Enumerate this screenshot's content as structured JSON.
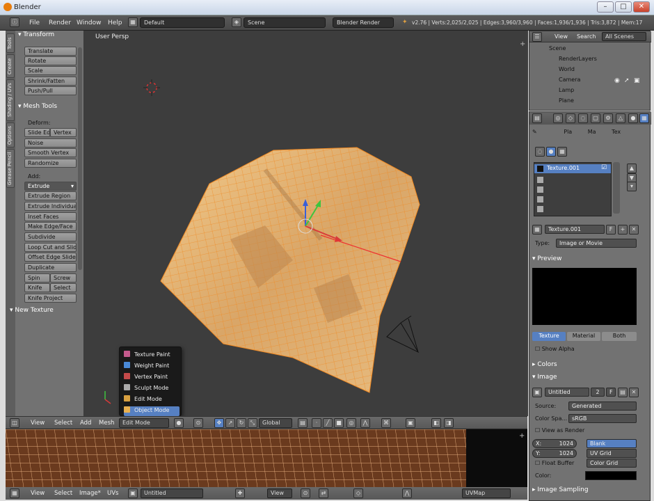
{
  "titlebar": {
    "title": "Blender"
  },
  "menubar": {
    "menus": [
      "File",
      "Render",
      "Window",
      "Help"
    ],
    "layout": "Default",
    "scene": "Scene",
    "engine": "Blender Render",
    "stats": "v2.76 | Verts:2,025/2,025 | Edges:3,960/3,960 | Faces:1,936/1,936 | Tris:3,872 | Mem:17"
  },
  "tool_tabs": [
    "Tools",
    "Create",
    "Shading / UVs",
    "Options",
    "Grease Pencil"
  ],
  "tools": {
    "transform_header": "Transform",
    "transform": [
      "Translate",
      "Rotate",
      "Scale",
      "Shrink/Fatten",
      "Push/Pull"
    ],
    "mesh_header": "Mesh Tools",
    "deform_label": "Deform:",
    "slide_edge": "Slide Ed",
    "vertex": "Vertex",
    "deform": [
      "Noise",
      "Smooth Vertex",
      "Randomize"
    ],
    "add_label": "Add:",
    "extrude": "Extrude",
    "add": [
      "Extrude Region",
      "Extrude Individual",
      "Inset Faces",
      "Make Edge/Face",
      "Subdivide",
      "Loop Cut and Slide",
      "Offset Edge Slide",
      "Duplicate"
    ],
    "spin": "Spin",
    "screw": "Screw",
    "knife": "Knife",
    "select": "Select",
    "knife_project": "Knife Project",
    "new_texture": "New Texture"
  },
  "viewport": {
    "view_label": "User Persp"
  },
  "mode_menu": {
    "items": [
      "Texture Paint",
      "Weight Paint",
      "Vertex Paint",
      "Sculpt Mode",
      "Edit Mode",
      "Object Mode"
    ]
  },
  "viewport_header": {
    "menus": [
      "View",
      "Select",
      "Add",
      "Mesh"
    ],
    "mode": "Edit Mode",
    "orientation": "Global"
  },
  "uv_header": {
    "menus": [
      "View",
      "Select",
      "Image*",
      "UVs"
    ],
    "image": "Untitled",
    "view": "View",
    "uvmap": "UVMap"
  },
  "outliner": {
    "tabs": [
      "View",
      "Search",
      "All Scenes"
    ],
    "items": [
      "Scene",
      "RenderLayers",
      "World",
      "Camera",
      "Lamp",
      "Plane"
    ]
  },
  "properties": {
    "context_tabs": [
      "Pla",
      "Ma",
      "Tex"
    ],
    "texture_slot": "Texture.001",
    "texture_name": "Texture.001",
    "type_label": "Type:",
    "type_value": "Image or Movie",
    "preview_header": "Preview",
    "preview_tabs": [
      "Texture",
      "Material",
      "Both"
    ],
    "show_alpha": "Show Alpha",
    "colors_header": "Colors",
    "image_header": "Image",
    "image_name": "Untitled",
    "image_users": "2",
    "image_fake": "F",
    "source_label": "Source:",
    "source_value": "Generated",
    "colorspace_label": "Color Spa...",
    "colorspace_value": "sRGB",
    "view_as_render": "View as Render",
    "x_label": "X:",
    "x_value": "1024",
    "y_label": "Y:",
    "y_value": "1024",
    "gen_types": [
      "Blank",
      "UV Grid",
      "Color Grid"
    ],
    "float_buffer": "Float Buffer",
    "color_label": "Color:",
    "image_sampling": "Image Sampling"
  },
  "colors": {
    "accent": "#5680c2",
    "mesh": "#e0a860",
    "mesh_wire": "#f08a24"
  }
}
